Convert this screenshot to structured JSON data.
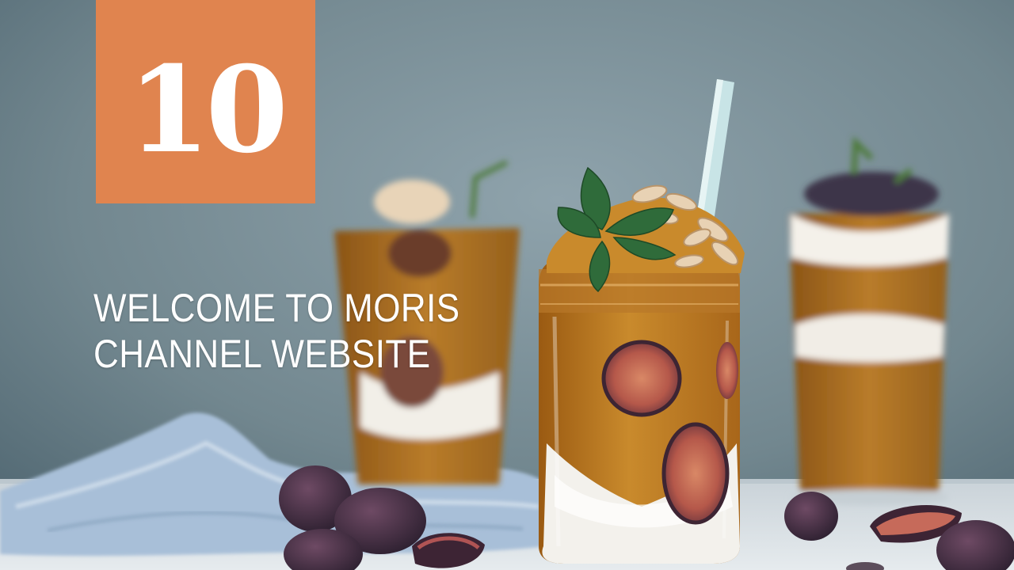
{
  "slide": {
    "number": "10",
    "title": "WELCOME TO MORIS\nCHANNEL  WEBSITE"
  },
  "colors": {
    "badge": "#e0844f",
    "text": "#ffffff",
    "wall": "#6f8591"
  },
  "image": {
    "subject": "smoothie-jars-with-figs"
  }
}
